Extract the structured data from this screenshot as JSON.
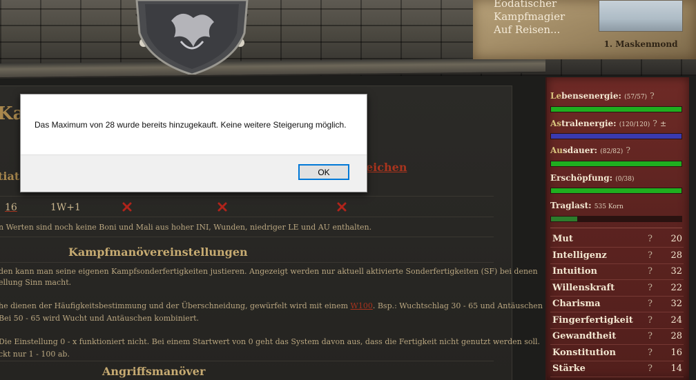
{
  "character": {
    "lines": [
      "Eodatischer",
      "Kampfmagier",
      "Auf Reisen..."
    ],
    "date": "1. Maskenmond"
  },
  "main": {
    "title_fragment": "Kam",
    "initiative_fragment": "tiat",
    "right_link_fragment": "eichen",
    "row": {
      "value": "16",
      "dice": "1W+1"
    },
    "note": "n Werten sind noch keine Boni und Mali aus hoher INI, Wunden, niedriger LE und AU enthalten.",
    "kampf_section": {
      "title": "Kampfmanövereinstellungen",
      "p1_line1": "den kann man seine eigenen Kampfsonderfertigkeiten justieren. Angezeigt werden nur aktuell aktivierte Sonderfertigkeiten (SF) bei denen",
      "p1_line2": "ellung Sinn macht.",
      "p2_line1_pre": "he dienen der Häufigkeitsbestimmung und der Überschneidung, gewürfelt wird mit einem ",
      "p2_link": "W100",
      "p2_line1_post": ". Bsp.: Wuchtschlag 30 - 65 und Antäuschen",
      "p2_line2": "Bei 50 - 65 wird Wucht und Antäuschen kombiniert.",
      "p3_line1": "Die Einstellung 0 - x funktioniert nicht. Bei einem Startwert von 0 geht das System davon aus, dass die Fertigkeit nicht genutzt werden soll.",
      "p3_line2": "ckt nur 1 - 100 ab."
    },
    "angriff_title": "Angriffsmanöver"
  },
  "stats": {
    "lebensenergie": {
      "first": "Le",
      "rest": "bensenergie:",
      "value": "(57/57)",
      "q": "?",
      "fill": 1.0,
      "color": "#1fae1f"
    },
    "astralenergie": {
      "first": "As",
      "rest": "tralenergie:",
      "value": "(120/120)",
      "q": "?",
      "pm": "±",
      "fill": 1.0,
      "color": "#3a3ab0"
    },
    "ausdauer": {
      "first": "Au",
      "rest": "sdauer:",
      "value": "(82/82)",
      "q": "?",
      "fill": 1.0,
      "color": "#1fae1f"
    },
    "erschoepfung": {
      "first": "",
      "rest": "Erschöpfung:",
      "value": "(0/38)",
      "fill": 1.0,
      "color": "#1fae1f"
    },
    "traglast": {
      "first": "",
      "rest": "Traglast:",
      "value": "535 Korn",
      "fill": 0.2,
      "color": "#2c7d2c"
    }
  },
  "attributes": [
    {
      "name": "Mut",
      "q": "?",
      "value": "20"
    },
    {
      "name": "Intelligenz",
      "q": "?",
      "value": "28"
    },
    {
      "name": "Intuition",
      "q": "?",
      "value": "32"
    },
    {
      "name": "Willenskraft",
      "q": "?",
      "value": "22"
    },
    {
      "name": "Charisma",
      "q": "?",
      "value": "32"
    },
    {
      "name": "Fingerfertigkeit",
      "q": "?",
      "value": "24"
    },
    {
      "name": "Gewandtheit",
      "q": "?",
      "value": "28"
    },
    {
      "name": "Konstitution",
      "q": "?",
      "value": "16"
    },
    {
      "name": "Stärke",
      "q": "?",
      "value": "14"
    }
  ],
  "dialog": {
    "message": "Das Maximum von 28 wurde bereits hinzugekauft. Keine weitere Steigerung möglich.",
    "ok_label": "OK"
  }
}
